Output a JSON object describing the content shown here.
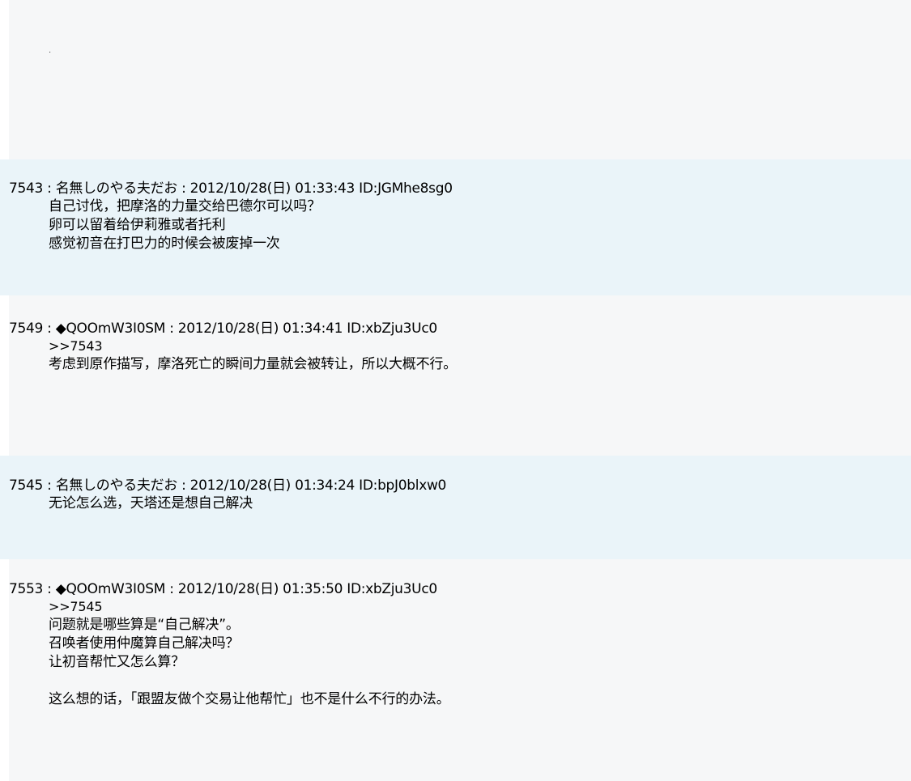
{
  "intro": {
    "dot": "."
  },
  "posts": [
    {
      "header": "7543 : 名無しのやる夫だお : 2012/10/28(日) 01:33:43 ID:JGMhe8sg0",
      "anchor": "",
      "lines": [
        "自己讨伐，把摩洛的力量交给巴德尔可以吗？",
        "卵可以留着给伊莉雅或者托利",
        "感觉初音在打巴力的时候会被废掉一次"
      ]
    },
    {
      "header": "7549 : ◆QOOmW3I0SM : 2012/10/28(日) 01:34:41 ID:xbZju3Uc0",
      "anchor": ">>7543",
      "lines": [
        "考虑到原作描写，摩洛死亡的瞬间力量就会被转让，所以大概不行。"
      ]
    },
    {
      "header": "7545 : 名無しのやる夫だお : 2012/10/28(日) 01:34:24 ID:bpJ0blxw0",
      "anchor": "",
      "lines": [
        "无论怎么选，天塔还是想自己解决"
      ]
    },
    {
      "header": "7553 : ◆QOOmW3I0SM : 2012/10/28(日) 01:35:50 ID:xbZju3Uc0",
      "anchor": ">>7545",
      "lines": [
        "问题就是哪些算是“自己解决”。",
        "召唤者使用仲魔算自己解决吗？",
        "让初音帮忙又怎么算？",
        "",
        "这么想的话，「跟盟友做个交易让他帮忙」也不是什么不行的办法。"
      ]
    }
  ]
}
